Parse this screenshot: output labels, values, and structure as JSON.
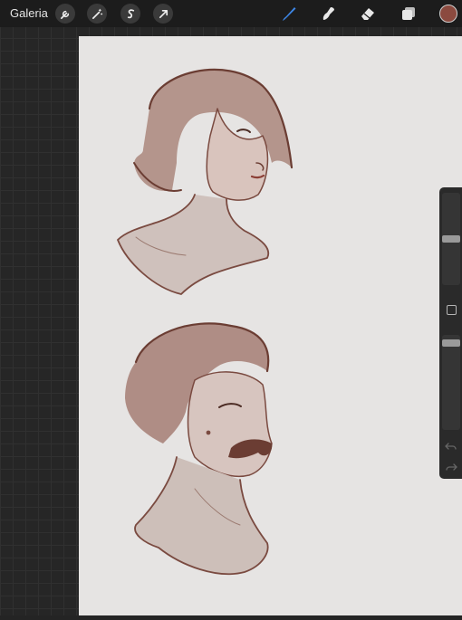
{
  "topbar": {
    "gallery_label": "Galeria",
    "left_tools": [
      "wrench-icon",
      "magic-wand-icon",
      "selection-s-icon",
      "transform-arrow-icon"
    ],
    "right_tools": [
      "brush-icon",
      "smudge-icon",
      "eraser-icon",
      "layers-icon"
    ],
    "active_tool": "brush",
    "active_color": "#8b4a3f",
    "accent": "#3d86e6"
  },
  "sidebar": {
    "brush_size_level": 0.5,
    "opacity_level": 0.05,
    "buttons": [
      "modify-square-icon",
      "undo-icon",
      "redo-icon"
    ]
  },
  "canvas": {
    "background": "#e6e4e3",
    "ink_color": "#7a4a40",
    "drawings": [
      "woman-portrait-sketch",
      "man-with-mustache-portrait-sketch"
    ]
  }
}
